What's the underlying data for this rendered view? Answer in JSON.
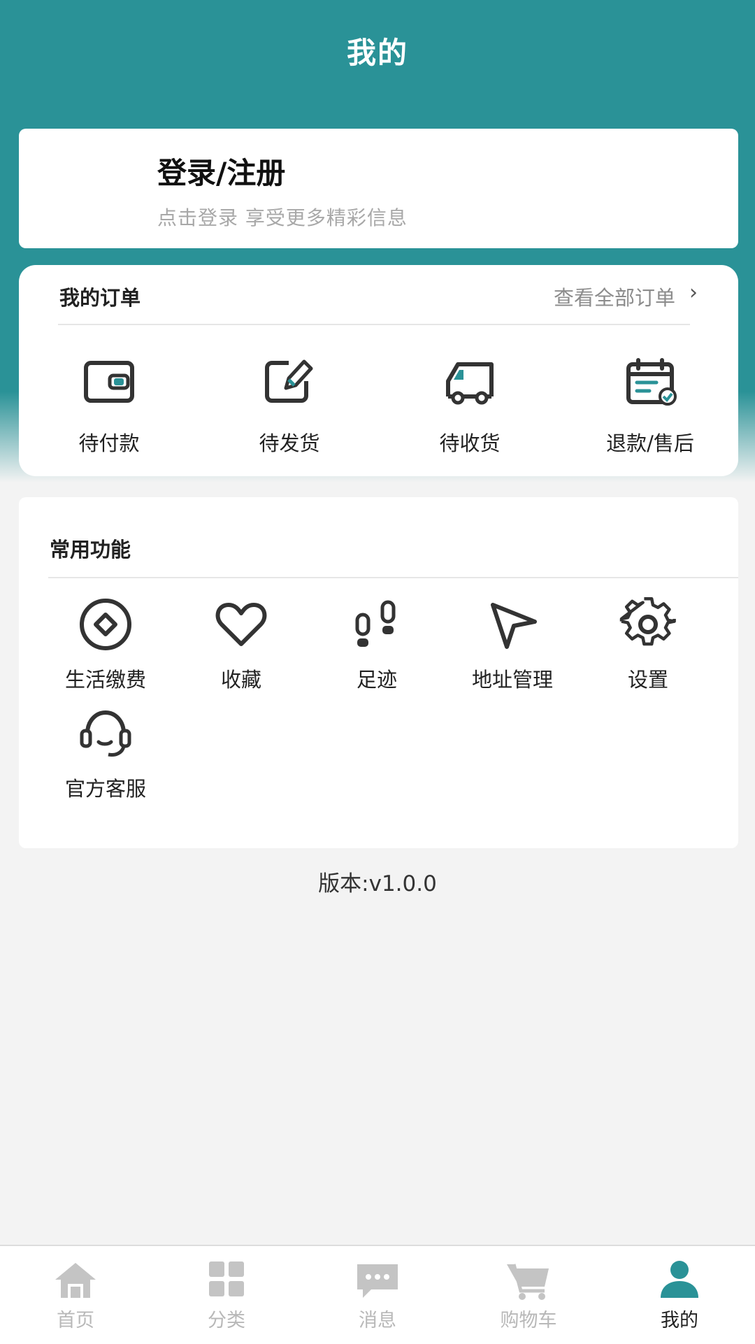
{
  "header": {
    "title": "我的"
  },
  "login": {
    "title": "登录/注册",
    "subtitle": "点击登录 享受更多精彩信息"
  },
  "orders": {
    "title": "我的订单",
    "view_all": "查看全部订单",
    "items": [
      {
        "label": "待付款",
        "icon": "wallet-icon"
      },
      {
        "label": "待发货",
        "icon": "edit-icon"
      },
      {
        "label": "待收货",
        "icon": "truck-icon"
      },
      {
        "label": "退款/售后",
        "icon": "calendar-refund-icon"
      }
    ]
  },
  "functions": {
    "title": "常用功能",
    "items": [
      {
        "label": "生活缴费",
        "icon": "payment-icon"
      },
      {
        "label": "收藏",
        "icon": "heart-icon"
      },
      {
        "label": "足迹",
        "icon": "footprint-icon"
      },
      {
        "label": "地址管理",
        "icon": "navigation-icon"
      },
      {
        "label": "设置",
        "icon": "gear-icon"
      },
      {
        "label": "官方客服",
        "icon": "headset-icon"
      }
    ]
  },
  "version": "版本:v1.0.0",
  "tabbar": {
    "items": [
      {
        "label": "首页",
        "icon": "home-icon"
      },
      {
        "label": "分类",
        "icon": "category-icon"
      },
      {
        "label": "消息",
        "icon": "message-icon"
      },
      {
        "label": "购物车",
        "icon": "cart-icon"
      },
      {
        "label": "我的",
        "icon": "user-icon"
      }
    ],
    "active_color": "#2a9297",
    "inactive_color": "#c4c4c4"
  },
  "colors": {
    "brand": "#2a9297",
    "background": "#f3f3f3"
  }
}
